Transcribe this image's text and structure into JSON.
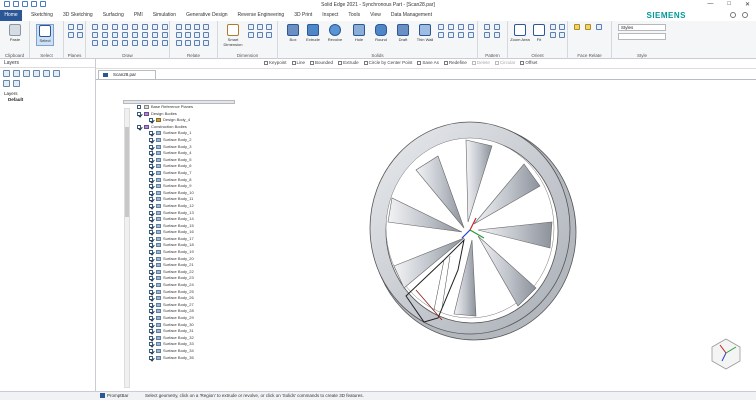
{
  "window": {
    "title": "Solid Edge 2021 - Synchronous Part - [Scan28.par]"
  },
  "ribbon": {
    "file_tab": "Home",
    "tabs": [
      "Sketching",
      "3D Sketching",
      "Surfacing",
      "PMI",
      "Simulation",
      "Generative Design",
      "Reverse Engineering",
      "3D Print",
      "Inspect",
      "Tools",
      "View",
      "Data Management"
    ],
    "brand": "SIEMENS",
    "groups": {
      "clipboard": "Clipboard",
      "select": "Select",
      "planes": "Planes",
      "draw": "Draw",
      "relate": "Relate",
      "dimension": "Dimension",
      "solids": "Solids",
      "pattern": "Pattern",
      "orient": "Orient",
      "face_relate": "Face Relate",
      "style": "Style"
    },
    "buttons": {
      "paste": "Paste",
      "select": "Select",
      "smart_dimension": "Smart Dimension",
      "box": "Box",
      "extrude": "Extrude",
      "revolve": "Revolve",
      "hole": "Hole",
      "round": "Round",
      "draft": "Draft",
      "thin_wall": "Thin Wall",
      "zoom_area": "Zoom Area",
      "fit": "Fit",
      "styles": "Styles"
    }
  },
  "command_bar": {
    "items": [
      {
        "label": "Keypoint",
        "enabled": true
      },
      {
        "label": "Line",
        "enabled": true
      },
      {
        "label": "Bounded",
        "enabled": true
      },
      {
        "label": "Extrude",
        "enabled": true
      },
      {
        "label": "Circle by Center Point",
        "enabled": true
      },
      {
        "label": "Save As",
        "enabled": true
      },
      {
        "label": "Redefine",
        "enabled": true
      },
      {
        "label": "Delete",
        "enabled": false
      },
      {
        "label": "Circular",
        "enabled": false
      },
      {
        "label": "Offset",
        "enabled": true
      }
    ]
  },
  "layers_panel": {
    "title": "Layers",
    "tree": {
      "root": "Layers",
      "child": "Default"
    }
  },
  "document_tab": "Scan28.par",
  "pathfinder": {
    "base_reference_planes": "Base Reference Planes",
    "design_bodies": "Design Bodies",
    "design_body_item": "Design Body_4",
    "construction_bodies": "Construction Bodies",
    "surface_bodies": [
      "Surface Body_1",
      "Surface Body_2",
      "Surface Body_3",
      "Surface Body_4",
      "Surface Body_5",
      "Surface Body_6",
      "Surface Body_7",
      "Surface Body_8",
      "Surface Body_9",
      "Surface Body_10",
      "Surface Body_11",
      "Surface Body_12",
      "Surface Body_13",
      "Surface Body_14",
      "Surface Body_15",
      "Surface Body_16",
      "Surface Body_17",
      "Surface Body_18",
      "Surface Body_19",
      "Surface Body_20",
      "Surface Body_21",
      "Surface Body_22",
      "Surface Body_23",
      "Surface Body_24",
      "Surface Body_25",
      "Surface Body_26",
      "Surface Body_27",
      "Surface Body_28",
      "Surface Body_29",
      "Surface Body_30",
      "Surface Body_31",
      "Surface Body_32",
      "Surface Body_33",
      "Surface Body_34",
      "Surface Body_35"
    ]
  },
  "status_bar": {
    "promptbar": "PromptBar",
    "message": "Select geometry, click on a 'Region' to extrude or revolve, or click on 'Solids' commands to create 3D features."
  },
  "colors": {
    "accent": "#2b5797",
    "brand": "#009999",
    "model_fill": "#c8ccd2"
  }
}
